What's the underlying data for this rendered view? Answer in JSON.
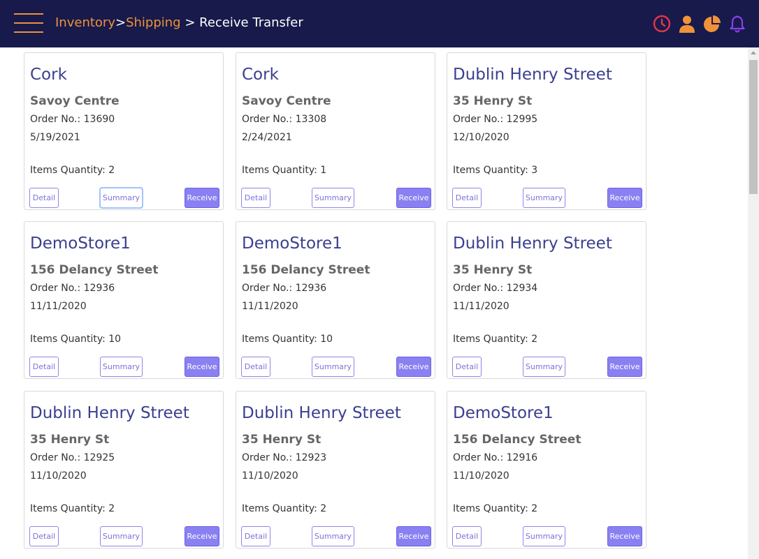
{
  "header": {
    "breadcrumb": {
      "inventory": "Inventory",
      "sep1": ">",
      "shipping": "Shipping",
      "current": "> Receive Transfer"
    },
    "icons": [
      "clock-icon",
      "user-icon",
      "pie-chart-icon",
      "bell-icon"
    ],
    "colors": {
      "background": "#171a4a",
      "accent": "#f0923a",
      "clock": "#e0344a",
      "bell": "#8a3ff0"
    }
  },
  "buttons": {
    "detail": "Detail",
    "summary": "Summary",
    "receive": "Receive"
  },
  "cards": [
    {
      "store": "Cork",
      "address": "Savoy Centre",
      "order": "Order No.: 13690",
      "date": "5/19/2021",
      "qty": "Items Quantity: 2"
    },
    {
      "store": "Cork",
      "address": "Savoy Centre",
      "order": "Order No.: 13308",
      "date": "2/24/2021",
      "qty": "Items Quantity: 1"
    },
    {
      "store": "Dublin Henry Street",
      "address": "35 Henry St",
      "order": "Order No.: 12995",
      "date": "12/10/2020",
      "qty": "Items Quantity: 3"
    },
    {
      "store": "DemoStore1",
      "address": "156 Delancy Street",
      "order": "Order No.: 12936",
      "date": "11/11/2020",
      "qty": "Items Quantity: 10"
    },
    {
      "store": "DemoStore1",
      "address": "156 Delancy Street",
      "order": "Order No.: 12936",
      "date": "11/11/2020",
      "qty": "Items Quantity: 10"
    },
    {
      "store": "Dublin Henry Street",
      "address": "35 Henry St",
      "order": "Order No.: 12934",
      "date": "11/11/2020",
      "qty": "Items Quantity: 2"
    },
    {
      "store": "Dublin Henry Street",
      "address": "35 Henry St",
      "order": "Order No.: 12925",
      "date": "11/10/2020",
      "qty": "Items Quantity: 2"
    },
    {
      "store": "Dublin Henry Street",
      "address": "35 Henry St",
      "order": "Order No.: 12923",
      "date": "11/10/2020",
      "qty": "Items Quantity: 2"
    },
    {
      "store": "DemoStore1",
      "address": "156 Delancy Street",
      "order": "Order No.: 12916",
      "date": "11/10/2020",
      "qty": "Items Quantity: 2"
    }
  ]
}
